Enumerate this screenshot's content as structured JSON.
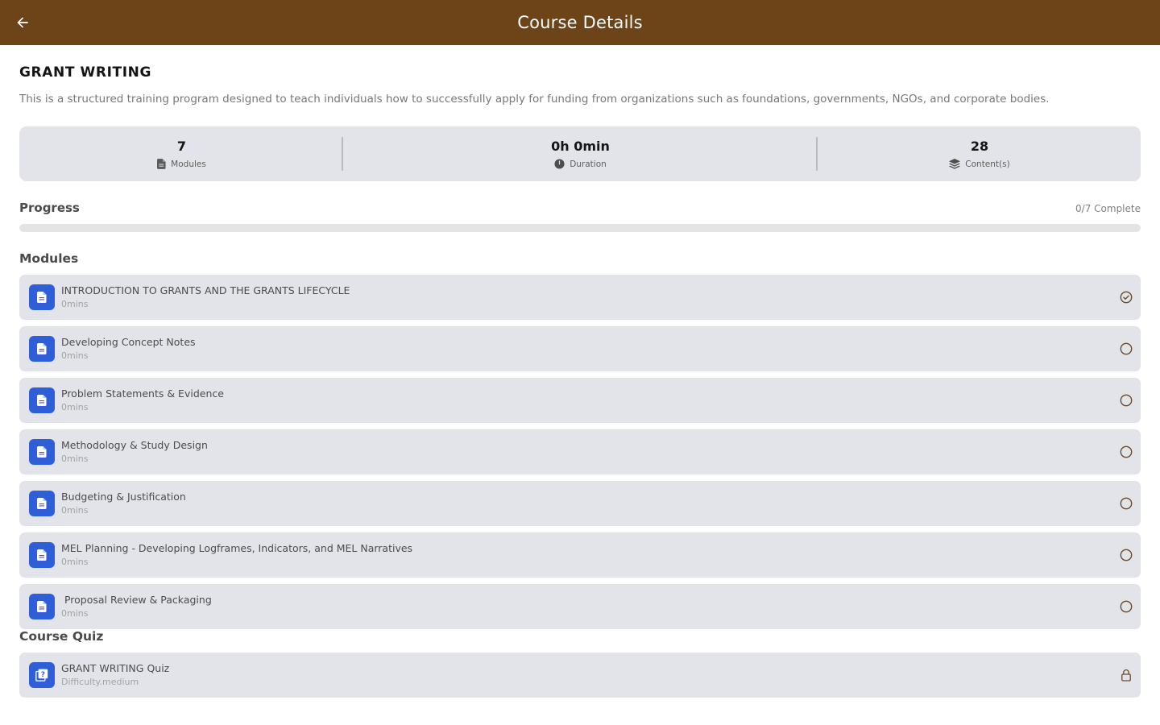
{
  "appbar": {
    "title": "Course Details",
    "back_icon": "arrow-left-icon"
  },
  "course": {
    "title": "GRANT WRITING",
    "description": "This  is a structured training program designed to teach individuals how to successfully apply for funding from organizations such as foundations, governments, NGOs, and corporate bodies."
  },
  "stats": {
    "modules": {
      "value": "7",
      "label": "Modules",
      "icon": "document-icon"
    },
    "duration": {
      "value": "0h 0min",
      "label": "Duration",
      "icon": "clock-icon"
    },
    "contents": {
      "value": "28",
      "label": "Content(s)",
      "icon": "layers-icon"
    }
  },
  "progress": {
    "title": "Progress",
    "text": "0/7 Complete",
    "completed": 0,
    "total": 7
  },
  "modules_section": {
    "title": "Modules",
    "items": [
      {
        "name": "INTRODUCTION TO GRANTS AND THE GRANTS LIFECYCLE",
        "duration": "0mins",
        "status": "completed"
      },
      {
        "name": "Developing Concept Notes",
        "duration": "0mins",
        "status": "not-started"
      },
      {
        "name": "Problem Statements & Evidence",
        "duration": "0mins",
        "status": "not-started"
      },
      {
        "name": "Methodology & Study Design",
        "duration": "0mins",
        "status": "not-started"
      },
      {
        "name": "Budgeting & Justification",
        "duration": "0mins",
        "status": "not-started"
      },
      {
        "name": "MEL Planning - Developing Logframes, Indicators, and MEL Narratives",
        "duration": "0mins",
        "status": "not-started"
      },
      {
        "name": " Proposal Review & Packaging",
        "duration": "0mins",
        "status": "not-started"
      }
    ]
  },
  "quiz_section": {
    "title": "Course Quiz",
    "quiz": {
      "name": "GRANT WRITING Quiz",
      "difficulty": "Difficulty.medium",
      "status": "locked",
      "icon": "quiz-icon"
    }
  },
  "colors": {
    "appbar": "#6d4318",
    "card": "#e3e4e9",
    "icon_bg": "#2f5fd8",
    "status": "#6b4a2a"
  }
}
